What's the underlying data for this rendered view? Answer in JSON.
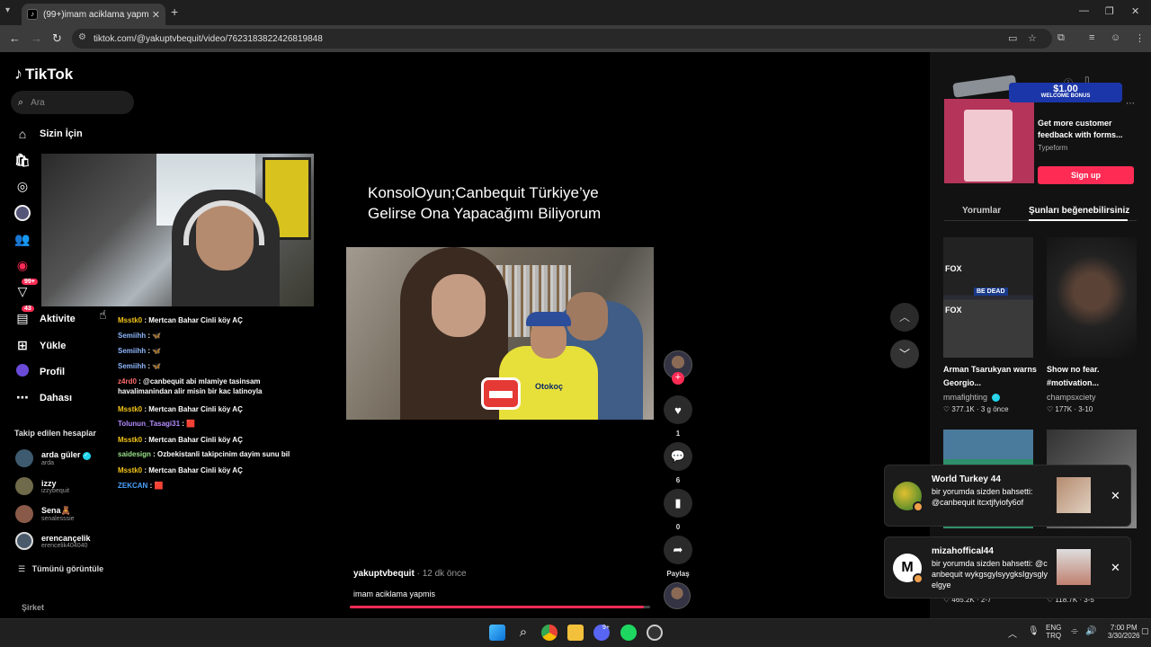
{
  "browser": {
    "tab_title": "(99+)imam aciklama yapmis | Ti",
    "tab_favicon": "tiktok-icon",
    "url": "tiktok.com/@yakuptvbequit/video/7623183822426819848"
  },
  "sidebar": {
    "logo": "TikTok",
    "search_placeholder": "Ara",
    "nav": [
      {
        "label": "Sizin İçin",
        "icon": "home-icon"
      },
      {
        "label": "Aktivite",
        "icon": "inbox-icon",
        "badge": "43"
      },
      {
        "label": "Yükle",
        "icon": "plus-square-icon"
      },
      {
        "label": "Profil",
        "icon": "profile-avatar"
      },
      {
        "label": "Dahası",
        "icon": "more-icon"
      }
    ],
    "partial_badge": "99+",
    "followed_title": "Takip edilen hesaplar",
    "followed": [
      {
        "name": "arda güler",
        "username": "arda",
        "verified": true
      },
      {
        "name": "izzy",
        "username": "izzybequit"
      },
      {
        "name": "Sena🧸",
        "username": "senalesssie"
      },
      {
        "name": "erencançelik",
        "username": "erencelik404040"
      }
    ],
    "see_all": "Tümünü görüntüle",
    "company": "Şirket"
  },
  "chat": [
    {
      "user": "Msstk0",
      "text": "Mertcan Bahar Cinli köy AÇ",
      "color": "#f5c518"
    },
    {
      "user": "Semiihh",
      "text": "🦋",
      "color": "#8fb8ff"
    },
    {
      "user": "Semiihh",
      "text": "🦋",
      "color": "#8fb8ff"
    },
    {
      "user": "Semiihh",
      "text": "🦋",
      "color": "#8fb8ff"
    },
    {
      "user": "z4rd0",
      "text": "@canbequit abi mlamiye tasinsam havalimanindan alir misin bir kac latinoyla",
      "color": "#ff6b6b"
    },
    {
      "user": "Msstk0",
      "text": "Mertcan Bahar Cinli köy AÇ",
      "color": "#f5c518"
    },
    {
      "user": "Tolunun_Tasagi31",
      "text": "🟥",
      "color": "#b48cff"
    },
    {
      "user": "Msstk0",
      "text": "Mertcan Bahar Cinli köy AÇ",
      "color": "#f5c518"
    },
    {
      "user": "saidesign",
      "text": "Ozbekistanli takipcinim dayim sunu bil",
      "color": "#9be28a"
    },
    {
      "user": "Msstk0",
      "text": "Mertcan Bahar Cinli köy AÇ",
      "color": "#f5c518"
    },
    {
      "user": "ZEKCAN",
      "text": "🟥",
      "color": "#4aa3ff"
    }
  ],
  "video": {
    "overlay_title_line1": "KonsolOyun;Canbequit Türkiye’ye",
    "overlay_title_line2": "Gelirse Ona Yapacağımı Biliyorum",
    "jersey_text": "Otokoç",
    "author": "yakuptvbequit",
    "time_ago": "12 dk önce",
    "description": "imam aciklama yapmis",
    "progress": 0.98
  },
  "actions": {
    "likes": "1",
    "comments": "6",
    "saves": "0",
    "share_label": "Paylaş"
  },
  "ad": {
    "banner_amount": "$1.00",
    "banner_text": "WELCOME BONUS",
    "text": "Get more customer feedback with forms...",
    "brand": "Typeform",
    "button": "Sign up"
  },
  "right_tabs": [
    "Yorumlar",
    "Şunları beğenebilirsiniz"
  ],
  "recommended": [
    {
      "title": "Arman Tsarukyan warns Georgio...",
      "user": "mmafighting",
      "verified": true,
      "stats": "377.1K · 3 g önce",
      "overlay": "BE DEAD",
      "brand": "FOX"
    },
    {
      "title": "Show no fear. #motivation...",
      "user": "champsxciety",
      "stats": "177K · 3-10"
    },
    {
      "stats": "465.2K · 2-7"
    },
    {
      "stats": "118.7K · 3-5"
    }
  ],
  "notifications": [
    {
      "title": "World Turkey 44",
      "message": "bir yorumda sizden bahsetti: @canbequit itcxtjfyiofy6of"
    },
    {
      "title": "mizahoffical44",
      "message": "bir yorumda sizden bahsetti: @canbequit wykgsgylsyygksIgysglyelgye",
      "avatar_letter": "M"
    }
  ],
  "taskbar": {
    "lang_top": "ENG",
    "lang_bottom": "TRQ",
    "time": "7:00 PM",
    "date": "3/30/2026",
    "discord_badge": "9+"
  }
}
